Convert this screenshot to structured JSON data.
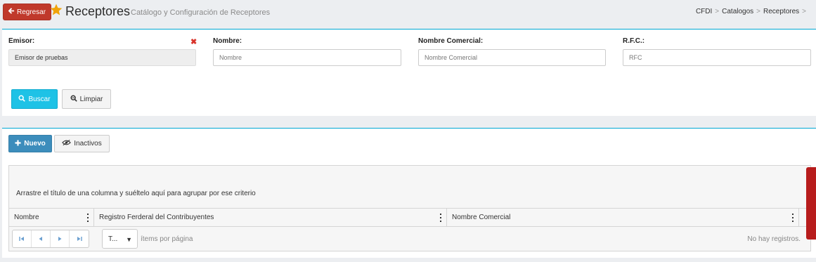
{
  "header": {
    "back_label": "Regresar",
    "title": "Receptores",
    "subtitle": "Catálogo y Configuración de Receptores",
    "breadcrumb": [
      "CFDI",
      "Catalogos",
      "Receptores"
    ],
    "accent_color": "#00a8d4"
  },
  "filters": {
    "emisor": {
      "label": "Emisor:",
      "value": "Emisor de pruebas"
    },
    "nombre": {
      "label": "Nombre:",
      "placeholder": "Nombre"
    },
    "nombre_comercial": {
      "label": "Nombre Comercial:",
      "placeholder": "Nombre Comercial"
    },
    "rfc": {
      "label": "R.F.C.:",
      "placeholder": "RFC"
    },
    "search_label": "Buscar",
    "clear_label": "Limpiar"
  },
  "toolbar": {
    "new_label": "Nuevo",
    "inactive_label": "Inactivos"
  },
  "grid": {
    "group_hint": "Arrastre el título de una columna y suéltelo aquí para agrupar por ese criterio",
    "columns": [
      "Nombre",
      "Registro Ferderal del Contribuyentes",
      "Nombre Comercial"
    ],
    "page_size": "T...",
    "per_page_label": "ítems por página",
    "empty_label": "No hay registros."
  }
}
